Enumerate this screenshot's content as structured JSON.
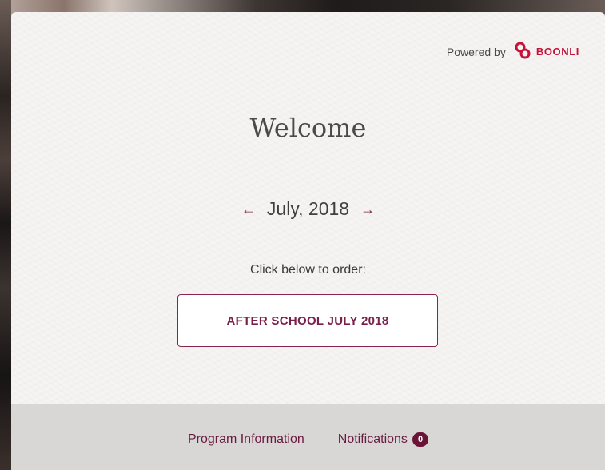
{
  "branding": {
    "powered_by": "Powered by",
    "brand_name": "BOONLI",
    "brand_color": "#c4123a"
  },
  "main": {
    "title": "Welcome",
    "month_label": "July, 2018",
    "prev_icon": "arrow-left-icon",
    "next_icon": "arrow-right-icon",
    "order_prompt": "Click below to order:",
    "order_button_label": "AFTER SCHOOL JULY 2018",
    "accent_color": "#7a1f4b"
  },
  "footer": {
    "links": [
      {
        "label": "Program Information"
      },
      {
        "label": "Notifications",
        "badge": "0"
      }
    ]
  }
}
